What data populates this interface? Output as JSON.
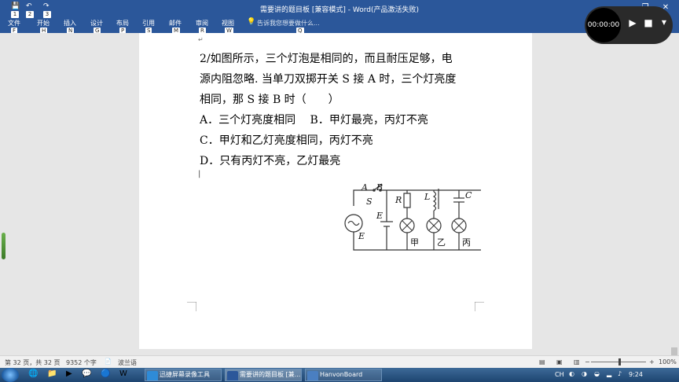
{
  "window": {
    "title": "需要讲的题目板 [兼容模式] - Word(产品激活失败)",
    "minimize": "—",
    "restore": "❐",
    "close": "✕"
  },
  "qat": {
    "items": [
      {
        "icon": "save-icon",
        "glyph": "💾",
        "key": "1"
      },
      {
        "icon": "undo-icon",
        "glyph": "↶",
        "key": "2"
      },
      {
        "icon": "redo-icon",
        "glyph": "↷",
        "key": "3"
      }
    ]
  },
  "ribbon": {
    "tabs": [
      {
        "label": "文件",
        "key": "F"
      },
      {
        "label": "开始",
        "key": "H"
      },
      {
        "label": "插入",
        "key": "N"
      },
      {
        "label": "设计",
        "key": "G"
      },
      {
        "label": "布局",
        "key": "P"
      },
      {
        "label": "引用",
        "key": "S"
      },
      {
        "label": "邮件",
        "key": "M"
      },
      {
        "label": "审阅",
        "key": "R"
      },
      {
        "label": "视图",
        "key": "W"
      }
    ],
    "tellme": "告诉我您想要做什么...",
    "tellme_key": "Q"
  },
  "recorder": {
    "timer": "00:00:00",
    "play_icon": "▶",
    "stop_icon": "■",
    "menu_icon": "▼"
  },
  "document": {
    "question_lines": [
      "2/如图所示，三个灯泡是相同的，而且耐压足够，电",
      "源内阻忽略. 当单刀双掷开关 S 接 A 时，三个灯亮度",
      "相同，那 S 接 B 时（　　）"
    ],
    "options": [
      "A．三个灯亮度相同　 B．甲灯最亮，丙灯不亮",
      "C．甲灯和乙灯亮度相同，丙灯不亮",
      "D．只有丙灯不亮，乙灯最亮"
    ],
    "circuit": {
      "labels": {
        "A": "A",
        "B": "B",
        "S": "S",
        "E_battery": "E",
        "E_ac": "E",
        "R": "R",
        "L": "L",
        "C": "C",
        "lamp1": "甲",
        "lamp2": "乙",
        "lamp3": "丙"
      }
    }
  },
  "statusbar": {
    "page": "第 32 页，共 32 页",
    "words": "9352 个字",
    "language": "波兰语",
    "zoom": "100%",
    "zoom_level": 100
  },
  "taskbar": {
    "apps": [
      {
        "label": "迅捷屏幕录像工具",
        "icon": "recorder-app-icon",
        "color": "#2e8bd8"
      },
      {
        "label": "需要讲的题目板 [兼...",
        "icon": "word-app-icon",
        "color": "#2b579a"
      },
      {
        "label": "HanvonBoard",
        "icon": "hanvon-app-icon",
        "color": "#4a7fc1"
      }
    ],
    "clock": "9:24"
  }
}
